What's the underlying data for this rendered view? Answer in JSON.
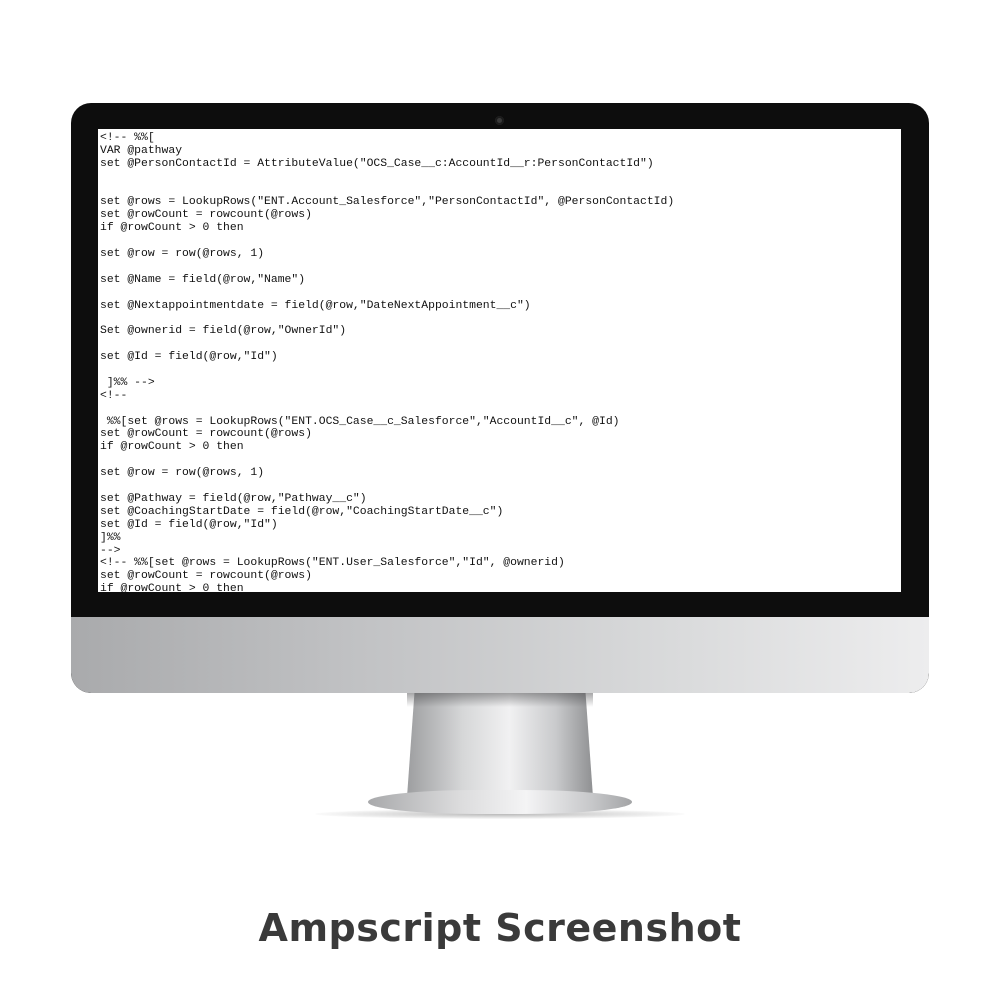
{
  "code_lines": [
    "<!-- %%[",
    "VAR @pathway",
    "set @PersonContactId = AttributeValue(\"OCS_Case__c:AccountId__r:PersonContactId\")",
    "",
    "",
    "set @rows = LookupRows(\"ENT.Account_Salesforce\",\"PersonContactId\", @PersonContactId)",
    "set @rowCount = rowcount(@rows)",
    "if @rowCount > 0 then",
    "",
    "set @row = row(@rows, 1)",
    "",
    "set @Name = field(@row,\"Name\")",
    "",
    "set @Nextappointmentdate = field(@row,\"DateNextAppointment__c\")",
    "",
    "Set @ownerid = field(@row,\"OwnerId\")",
    "",
    "set @Id = field(@row,\"Id\")",
    "",
    " ]%% -->",
    "<!--",
    "",
    " %%[set @rows = LookupRows(\"ENT.OCS_Case__c_Salesforce\",\"AccountId__c\", @Id)",
    "set @rowCount = rowcount(@rows)",
    "if @rowCount > 0 then",
    "",
    "set @row = row(@rows, 1)",
    "",
    "set @Pathway = field(@row,\"Pathway__c\")",
    "set @CoachingStartDate = field(@row,\"CoachingStartDate__c\")",
    "set @Id = field(@row,\"Id\")",
    "]%%",
    "-->",
    "<!-- %%[set @rows = LookupRows(\"ENT.User_Salesforce\",\"Id\", @ownerid)",
    "set @rowCount = rowcount(@rows)",
    "if @rowCount > 0 then"
  ],
  "caption": "Ampscript Screenshot"
}
